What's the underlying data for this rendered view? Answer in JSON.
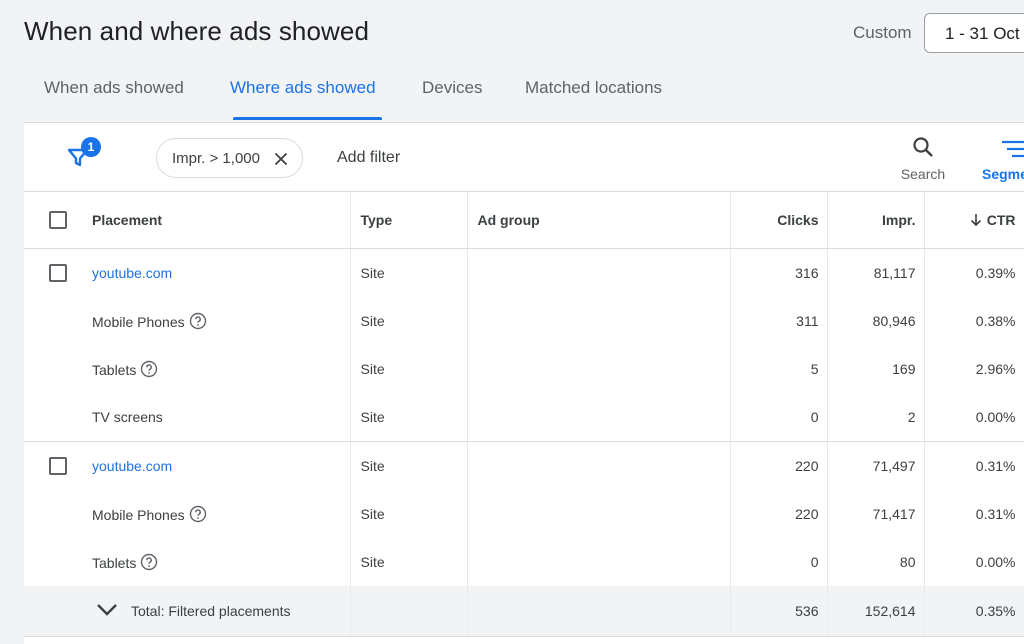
{
  "header": {
    "title": "When and where ads showed",
    "range_label": "Custom",
    "date_range": "1 - 31 Oct"
  },
  "tabs": [
    {
      "label": "When ads showed",
      "active": false
    },
    {
      "label": "Where ads showed",
      "active": true
    },
    {
      "label": "Devices",
      "active": false
    },
    {
      "label": "Matched locations",
      "active": false
    }
  ],
  "toolbar": {
    "filter_count": "1",
    "filter_chip": "Impr. > 1,000",
    "add_filter": "Add filter",
    "search_label": "Search",
    "segment_label": "Segments"
  },
  "table": {
    "columns": {
      "placement": "Placement",
      "type": "Type",
      "ad_group": "Ad group",
      "clicks": "Clicks",
      "impr": "Impr.",
      "ctr": "CTR"
    },
    "rows": [
      {
        "placement": "youtube.com",
        "type": "Site",
        "ad_group": "",
        "clicks": "316",
        "impr": "81,117",
        "ctr": "0.39%"
      },
      {
        "placement": "Mobile Phones",
        "type": "Site",
        "ad_group": "",
        "clicks": "311",
        "impr": "80,946",
        "ctr": "0.38%"
      },
      {
        "placement": "Tablets",
        "type": "Site",
        "ad_group": "",
        "clicks": "5",
        "impr": "169",
        "ctr": "2.96%"
      },
      {
        "placement": "TV screens",
        "type": "Site",
        "ad_group": "",
        "clicks": "0",
        "impr": "2",
        "ctr": "0.00%"
      },
      {
        "placement": "youtube.com",
        "type": "Site",
        "ad_group": "",
        "clicks": "220",
        "impr": "71,497",
        "ctr": "0.31%"
      },
      {
        "placement": "Mobile Phones",
        "type": "Site",
        "ad_group": "",
        "clicks": "220",
        "impr": "71,417",
        "ctr": "0.31%"
      },
      {
        "placement": "Tablets",
        "type": "Site",
        "ad_group": "",
        "clicks": "0",
        "impr": "80",
        "ctr": "0.00%"
      }
    ],
    "total": {
      "label": "Total: Filtered placements",
      "clicks": "536",
      "impr": "152,614",
      "ctr": "0.35%"
    }
  },
  "colors": {
    "accent": "#1a73e8",
    "text": "#202124",
    "muted": "#5f6368",
    "border": "#dadce0"
  },
  "icons": [
    "filter-icon",
    "close-icon",
    "search-icon",
    "segment-icon",
    "help-icon",
    "sort-down-icon",
    "chevron-down-icon"
  ]
}
